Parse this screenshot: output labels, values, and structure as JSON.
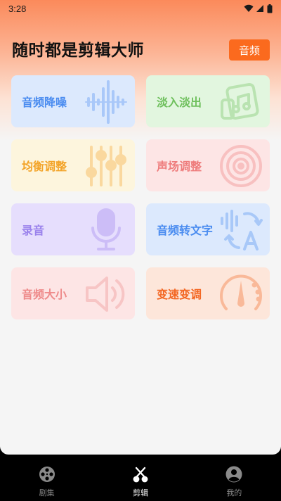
{
  "status_bar": {
    "time": "3:28"
  },
  "header": {
    "title": "随时都是剪辑大师",
    "audio_button": "音频"
  },
  "cards": [
    {
      "label": "音频降噪",
      "icon": "waveform-icon",
      "color": "#4a8cf0"
    },
    {
      "label": "淡入淡出",
      "icon": "music-file-icon",
      "color": "#6fc05d"
    },
    {
      "label": "均衡调整",
      "icon": "equalizer-sliders-icon",
      "color": "#f3a429"
    },
    {
      "label": "声场调整",
      "icon": "speaker-cone-icon",
      "color": "#ee7c7c"
    },
    {
      "label": "录音",
      "icon": "microphone-icon",
      "color": "#9a82ec"
    },
    {
      "label": "音频转文字",
      "icon": "speech-to-text-icon",
      "color": "#4a8cf0"
    },
    {
      "label": "音频大小",
      "icon": "volume-icon",
      "color": "#ee8a8a"
    },
    {
      "label": "变速变调",
      "icon": "speed-gauge-icon",
      "color": "#f36622"
    }
  ],
  "tabbar": {
    "tabs": [
      {
        "label": "剧集",
        "icon": "film-reel-icon",
        "active": false
      },
      {
        "label": "剪辑",
        "icon": "scissors-icon",
        "active": true
      },
      {
        "label": "我的",
        "icon": "profile-icon",
        "active": false
      }
    ]
  },
  "colors": {
    "accent": "#fb6a1e",
    "tab_active": "#ffffff",
    "tab_inactive": "#888888"
  }
}
